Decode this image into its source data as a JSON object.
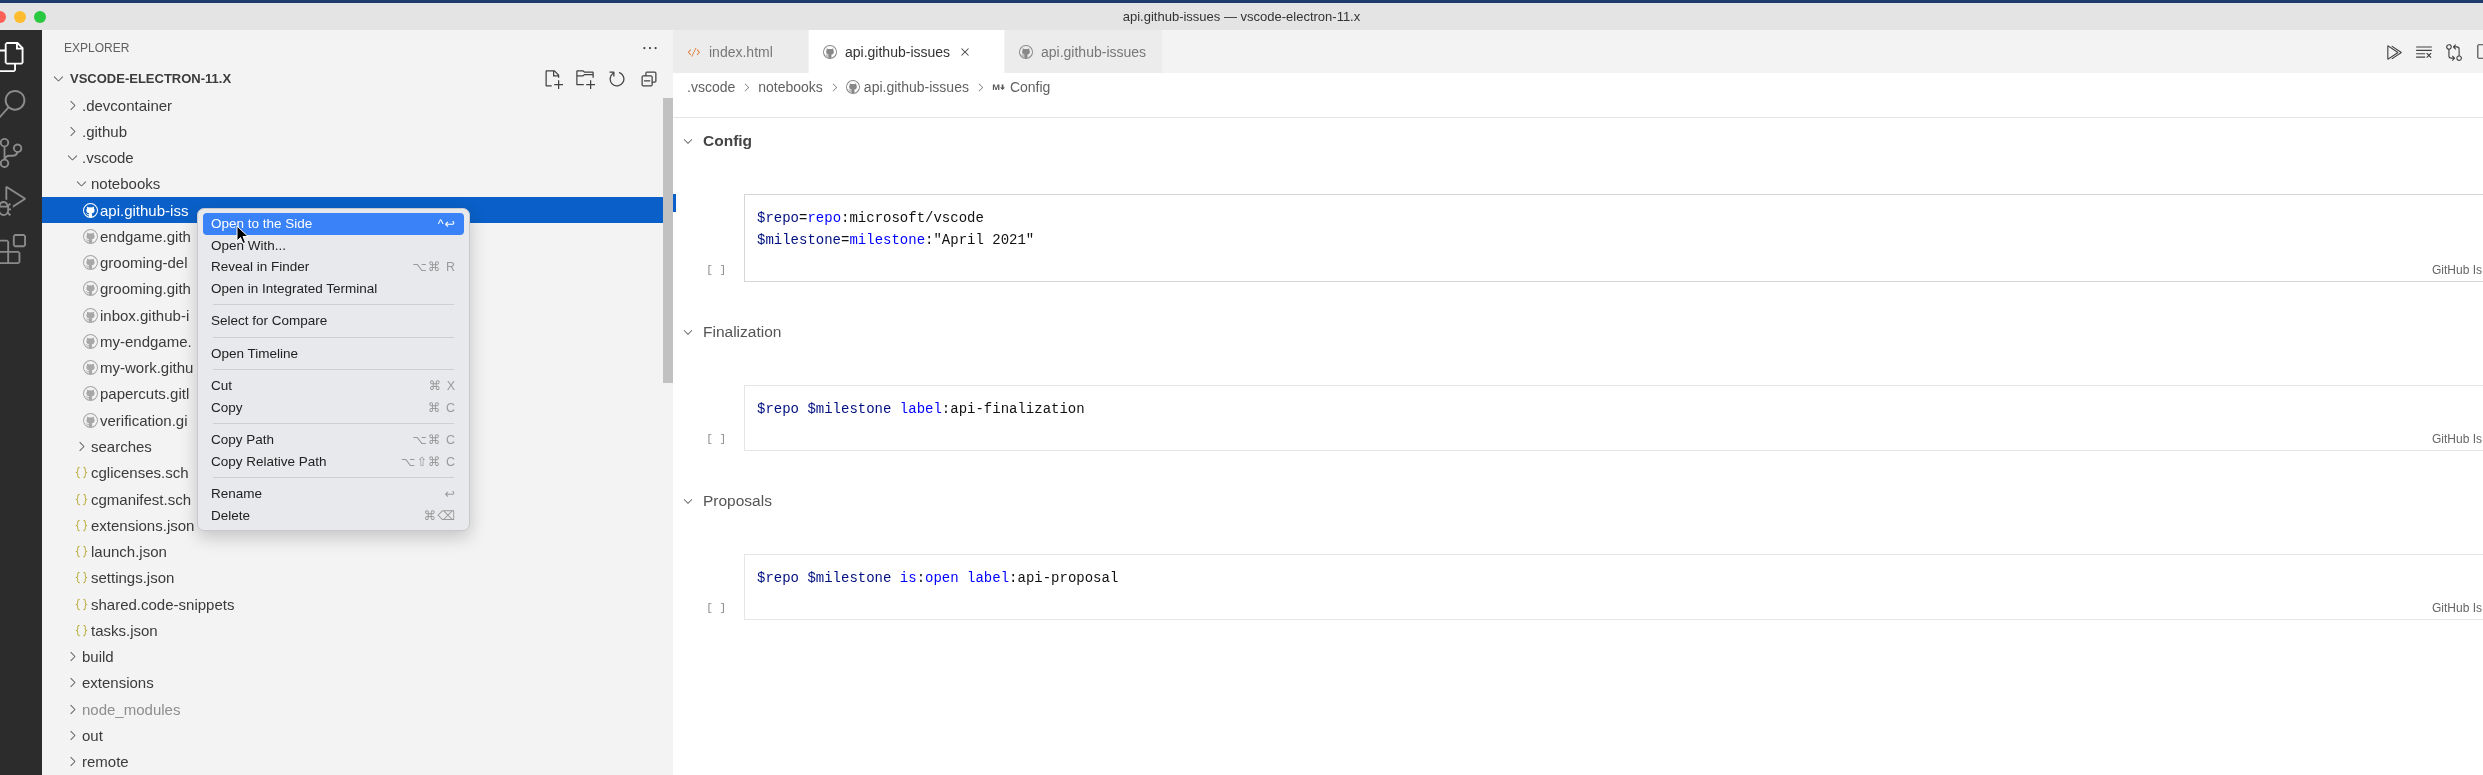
{
  "window": {
    "title": "api.github-issues — vscode-electron-11.x"
  },
  "activity_bar": [
    {
      "kind": "explorer",
      "selected": true
    },
    {
      "kind": "search",
      "selected": false
    },
    {
      "kind": "source-control",
      "selected": false
    },
    {
      "kind": "run",
      "selected": false
    },
    {
      "kind": "extensions",
      "selected": false
    }
  ],
  "sidebar": {
    "title": "EXPLORER",
    "root": {
      "label": "VSCODE-ELECTRON-11.X",
      "expanded": true,
      "children": [
        {
          "label": ".devcontainer",
          "kind": "folder",
          "expanded": false,
          "selected": false,
          "dimmed": false
        },
        {
          "label": ".github",
          "kind": "folder",
          "expanded": false,
          "selected": false,
          "dimmed": false
        },
        {
          "label": ".vscode",
          "kind": "folder",
          "expanded": true,
          "selected": false,
          "dimmed": false,
          "children": [
            {
              "label": "notebooks",
              "kind": "folder",
              "expanded": true,
              "selected": false,
              "dimmed": false,
              "children": [
                {
                  "label": "api.github-iss",
                  "kind": "notebook",
                  "selected": true,
                  "dimmed": false
                },
                {
                  "label": "endgame.gith",
                  "kind": "notebook",
                  "selected": false,
                  "dimmed": false
                },
                {
                  "label": "grooming-del",
                  "kind": "notebook",
                  "selected": false,
                  "dimmed": false
                },
                {
                  "label": "grooming.gith",
                  "kind": "notebook",
                  "selected": false,
                  "dimmed": false
                },
                {
                  "label": "inbox.github-i",
                  "kind": "notebook",
                  "selected": false,
                  "dimmed": false
                },
                {
                  "label": "my-endgame.",
                  "kind": "notebook",
                  "selected": false,
                  "dimmed": false
                },
                {
                  "label": "my-work.githu",
                  "kind": "notebook",
                  "selected": false,
                  "dimmed": false
                },
                {
                  "label": "papercuts.gitl",
                  "kind": "notebook",
                  "selected": false,
                  "dimmed": false
                },
                {
                  "label": "verification.gi",
                  "kind": "notebook",
                  "selected": false,
                  "dimmed": false
                }
              ]
            },
            {
              "label": "searches",
              "kind": "folder",
              "expanded": false,
              "selected": false,
              "dimmed": false
            },
            {
              "label": "cglicenses.sch",
              "kind": "json",
              "selected": false,
              "dimmed": false
            },
            {
              "label": "cgmanifest.sch",
              "kind": "json",
              "selected": false,
              "dimmed": false
            },
            {
              "label": "extensions.json",
              "kind": "json",
              "selected": false,
              "dimmed": false
            },
            {
              "label": "launch.json",
              "kind": "json",
              "selected": false,
              "dimmed": false
            },
            {
              "label": "settings.json",
              "kind": "json",
              "selected": false,
              "dimmed": false
            },
            {
              "label": "shared.code-snippets",
              "kind": "json",
              "selected": false,
              "dimmed": false
            },
            {
              "label": "tasks.json",
              "kind": "json",
              "selected": false,
              "dimmed": false
            }
          ]
        },
        {
          "label": "build",
          "kind": "folder",
          "expanded": false,
          "selected": false,
          "dimmed": false
        },
        {
          "label": "extensions",
          "kind": "folder",
          "expanded": false,
          "selected": false,
          "dimmed": false
        },
        {
          "label": "node_modules",
          "kind": "folder",
          "expanded": false,
          "selected": false,
          "dimmed": true
        },
        {
          "label": "out",
          "kind": "folder",
          "expanded": false,
          "selected": false,
          "dimmed": false
        },
        {
          "label": "remote",
          "kind": "folder",
          "expanded": false,
          "selected": false,
          "dimmed": false
        }
      ]
    }
  },
  "context_menu": {
    "groups": [
      [
        {
          "label": "Open to the Side",
          "shortcut": "^↩",
          "selected": true
        },
        {
          "label": "Open With...",
          "selected": false
        },
        {
          "label": "Reveal in Finder",
          "shortcut": "⌥⌘ R",
          "selected": false
        },
        {
          "label": "Open in Integrated Terminal",
          "selected": false
        }
      ],
      [
        {
          "label": "Select for Compare",
          "selected": false
        }
      ],
      [
        {
          "label": "Open Timeline",
          "selected": false
        }
      ],
      [
        {
          "label": "Cut",
          "shortcut": "⌘ X",
          "selected": false
        },
        {
          "label": "Copy",
          "shortcut": "⌘ C",
          "selected": false
        }
      ],
      [
        {
          "label": "Copy Path",
          "shortcut": "⌥⌘ C",
          "selected": false
        },
        {
          "label": "Copy Relative Path",
          "shortcut": "⌥⇧⌘ C",
          "selected": false
        }
      ],
      [
        {
          "label": "Rename",
          "shortcut": "↩",
          "selected": false
        },
        {
          "label": "Delete",
          "shortcut": "⌘⌫",
          "selected": false
        }
      ]
    ]
  },
  "editor": {
    "tabs": [
      {
        "label": "index.html",
        "kind": "html",
        "selected": false
      },
      {
        "label": "api.github-issues",
        "kind": "notebook",
        "selected": true
      },
      {
        "label": "api.github-issues",
        "kind": "notebook",
        "selected": false
      }
    ],
    "breadcrumbs": [
      {
        "label": ".vscode",
        "kind": "folder"
      },
      {
        "label": "notebooks",
        "kind": "folder"
      },
      {
        "label": "api.github-issues",
        "kind": "notebook"
      },
      {
        "label": "Config",
        "kind": "markdown"
      }
    ],
    "sections": [
      {
        "title": "Config",
        "bold": true,
        "expanded": true,
        "cells": [
          {
            "focused": true,
            "execution": "[ ]",
            "language": "GitHub Is",
            "lines": [
              [
                {
                  "kind": "variable",
                  "text": "$repo"
                },
                {
                  "kind": "text",
                  "text": "="
                },
                {
                  "kind": "keyword",
                  "text": "repo"
                },
                {
                  "kind": "text",
                  "text": ":microsoft/vscode"
                }
              ],
              [
                {
                  "kind": "variable",
                  "text": "$milestone"
                },
                {
                  "kind": "text",
                  "text": "="
                },
                {
                  "kind": "keyword",
                  "text": "milestone"
                },
                {
                  "kind": "text",
                  "text": ":\"April 2021\""
                }
              ]
            ]
          }
        ]
      },
      {
        "title": "Finalization",
        "bold": false,
        "expanded": true,
        "cells": [
          {
            "focused": false,
            "execution": "[ ]",
            "language": "GitHub Is",
            "lines": [
              [
                {
                  "kind": "variable",
                  "text": "$repo $milestone "
                },
                {
                  "kind": "keyword",
                  "text": "label"
                },
                {
                  "kind": "text",
                  "text": ":api-finalization"
                }
              ]
            ]
          }
        ]
      },
      {
        "title": "Proposals",
        "bold": false,
        "expanded": true,
        "cells": [
          {
            "focused": false,
            "execution": "[ ]",
            "language": "GitHub Is",
            "lines": [
              [
                {
                  "kind": "variable",
                  "text": "$repo $milestone "
                },
                {
                  "kind": "keyword",
                  "text": "is"
                },
                {
                  "kind": "text",
                  "text": ":"
                },
                {
                  "kind": "keyword",
                  "text": "open "
                },
                {
                  "kind": "keyword",
                  "text": "label"
                },
                {
                  "kind": "text",
                  "text": ":api-proposal"
                }
              ]
            ]
          }
        ]
      }
    ]
  }
}
